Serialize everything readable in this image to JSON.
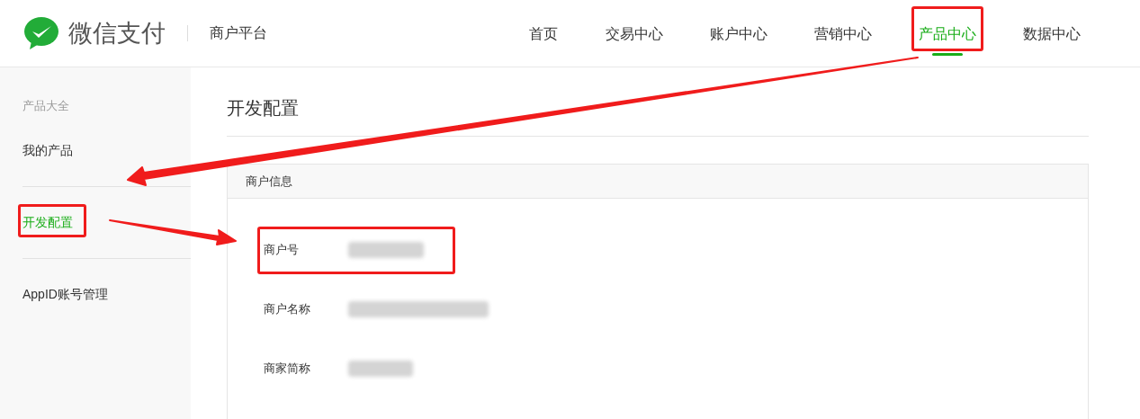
{
  "header": {
    "brand": "微信支付",
    "platform": "商户平台",
    "nav": [
      {
        "label": "首页",
        "selected": false,
        "highlighted": false
      },
      {
        "label": "交易中心",
        "selected": false,
        "highlighted": false
      },
      {
        "label": "账户中心",
        "selected": false,
        "highlighted": false
      },
      {
        "label": "营销中心",
        "selected": false,
        "highlighted": false
      },
      {
        "label": "产品中心",
        "selected": true,
        "highlighted": true
      },
      {
        "label": "数据中心",
        "selected": false,
        "highlighted": false
      }
    ]
  },
  "sidebar": {
    "heading": "产品大全",
    "groups": [
      [
        {
          "label": "我的产品",
          "selected": false,
          "highlighted": false
        }
      ],
      [
        {
          "label": "开发配置",
          "selected": true,
          "highlighted": true
        }
      ],
      [
        {
          "label": "AppID账号管理",
          "selected": false,
          "highlighted": false
        }
      ]
    ]
  },
  "main": {
    "title": "开发配置",
    "card": {
      "title": "商户信息",
      "rows": [
        {
          "label": "商户号",
          "highlighted": true
        },
        {
          "label": "商户名称",
          "highlighted": false
        },
        {
          "label": "商家简称",
          "highlighted": false
        }
      ]
    }
  }
}
